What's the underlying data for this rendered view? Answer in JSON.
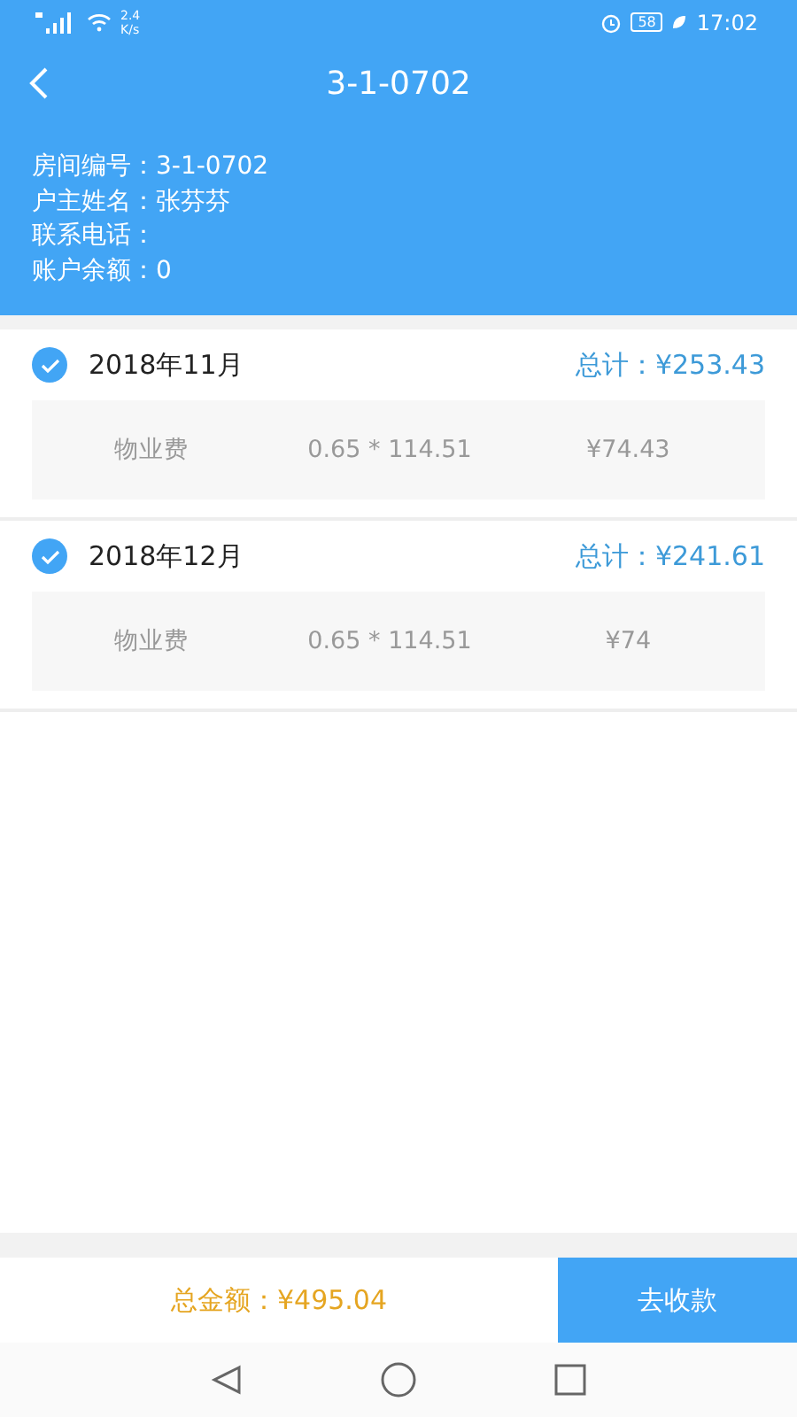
{
  "status_bar": {
    "speed": "2.4",
    "speed_unit": "K/s",
    "battery": "58",
    "time": "17:02"
  },
  "header": {
    "title": "3-1-0702"
  },
  "info": [
    {
      "label": "房间编号：",
      "value": "3-1-0702"
    },
    {
      "label": "户主姓名：",
      "value": "张芬芬"
    },
    {
      "label": "联系电话："
    },
    {
      "label": "账户余额：",
      "value": "0"
    }
  ],
  "bills": [
    {
      "month": "2018年11月",
      "checked": true,
      "total": "总计：¥253.43",
      "fees": [
        {
          "name": "物业费",
          "formula": "0.65 * 114.51",
          "amount": "¥74.43"
        }
      ]
    },
    {
      "month": "2018年12月",
      "checked": true,
      "total": "总计：¥241.61",
      "fees": [
        {
          "name": "物业费",
          "formula": "0.65 * 114.51",
          "amount": "¥74"
        }
      ]
    }
  ],
  "footer": {
    "total": "总金额：¥495.04",
    "button": "去收款"
  }
}
